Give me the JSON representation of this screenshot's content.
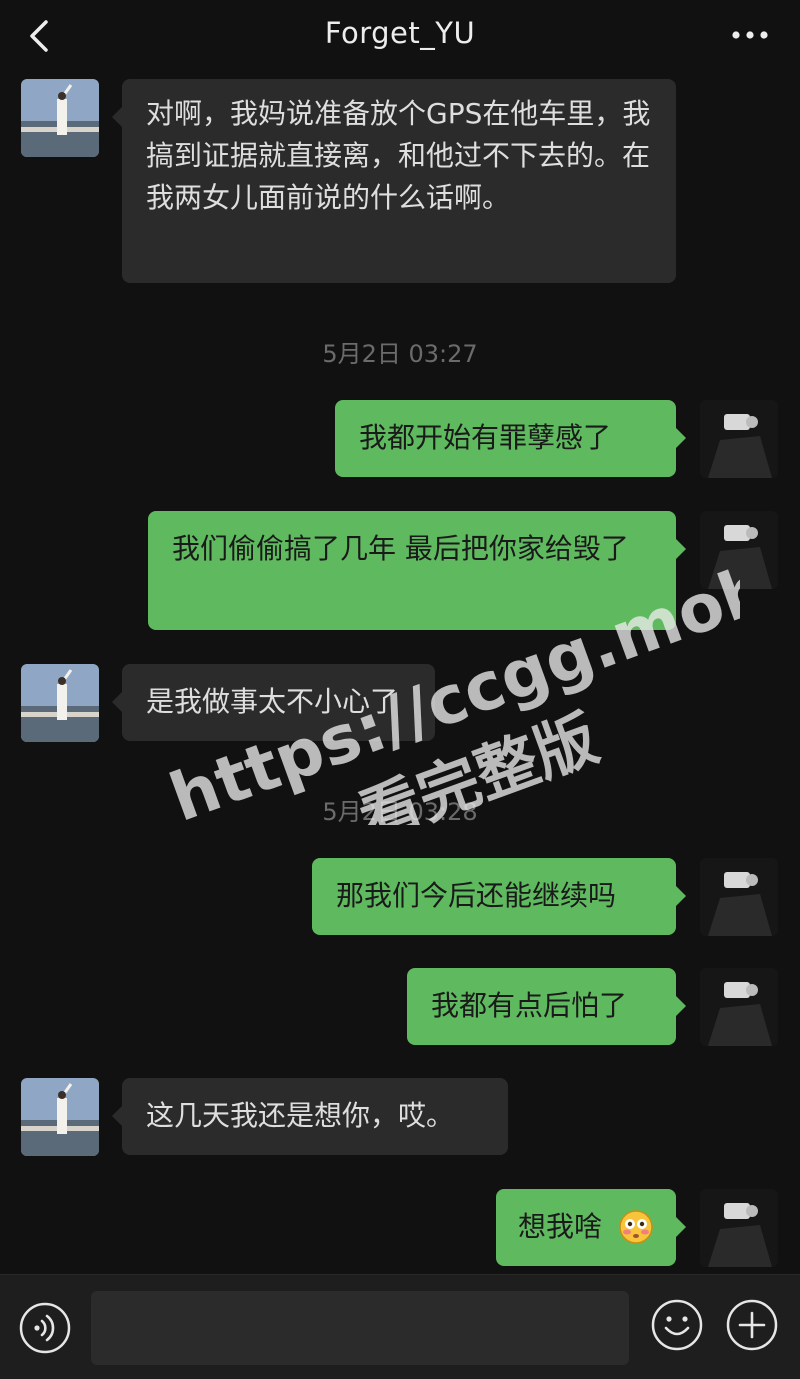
{
  "header": {
    "title": "Forget_YU"
  },
  "messages": [
    {
      "side": "in",
      "text": "对啊，我妈说准备放个GPS在他车里，我搞到证据就直接离，和他过不下去的。在我两女儿面前说的什么话啊。"
    },
    {
      "type": "time",
      "text": "5月2日 03:27"
    },
    {
      "side": "out",
      "text": "我都开始有罪孽感了"
    },
    {
      "side": "out",
      "text": "我们偷偷搞了几年 最后把你家给毁了"
    },
    {
      "side": "in",
      "text": "是我做事太不小心了"
    },
    {
      "type": "time",
      "text": "5月2日 03:28"
    },
    {
      "side": "out",
      "text": "那我们今后还能继续吗"
    },
    {
      "side": "out",
      "text": "我都有点后怕了"
    },
    {
      "side": "in",
      "text": "这几天我还是想你，哎。"
    },
    {
      "side": "out",
      "text": "想我啥",
      "emoji": "flushed-face-emoji"
    }
  ],
  "watermark": {
    "url": "https://ccgg.mobi",
    "caption": "看完整版"
  },
  "input_bar": {
    "placeholder": "",
    "voice_icon": "voice-icon",
    "emoji_icon": "emoji-icon",
    "plus_icon": "plus-icon"
  },
  "colors": {
    "background": "#111111",
    "incoming_bubble": "#2b2b2b",
    "outgoing_bubble": "#5fba5f",
    "timestamp": "#6b6b6b"
  }
}
